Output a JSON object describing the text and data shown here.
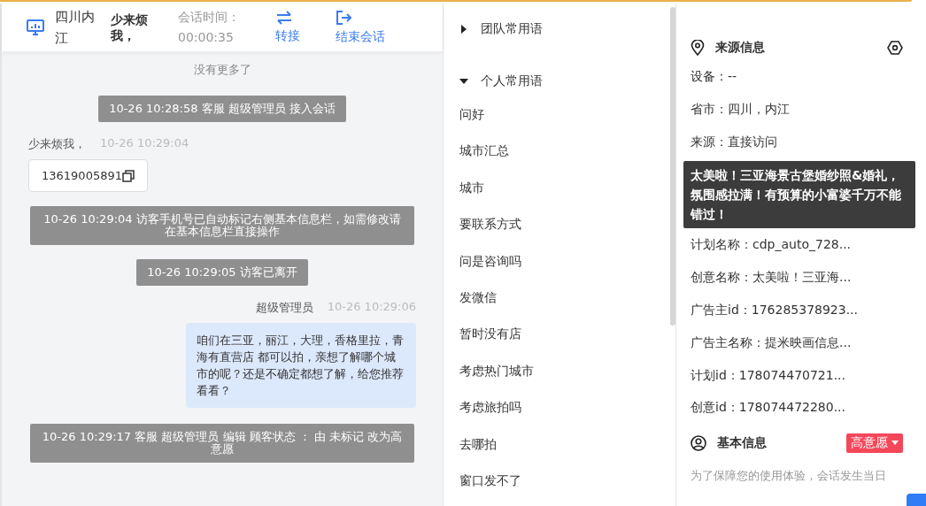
{
  "header": {
    "location": "四川内江",
    "visitor": "少来烦我，",
    "duration_label": "会话时间：",
    "duration": "00:00:35",
    "actions": [
      {
        "kind": "transfer",
        "label": "转接"
      },
      {
        "kind": "end",
        "label": "结束会话"
      }
    ]
  },
  "chat": [
    {
      "kind": "hint",
      "text": "没有更多了"
    },
    {
      "kind": "notice",
      "text": "10-26 10:28:58 客服 超级管理员 接入会话"
    },
    {
      "kind": "customer",
      "name": "少来烦我，",
      "time": "10-26 10:29:04",
      "text": "13619005891"
    },
    {
      "kind": "notice",
      "text": "10-26 10:29:04 访客手机号已自动标记右侧基本信息栏，如需修改请在基本信息栏直接操作"
    },
    {
      "kind": "notice",
      "text": "10-26 10:29:05 访客已离开"
    },
    {
      "kind": "agent",
      "name": "超级管理员",
      "time": "10-26 10:29:06",
      "text": "咱们在三亚，丽江，大理，香格里拉，青海有直营店 都可以拍，亲想了解哪个城市的呢？还是不确定都想了解，给您推荐看看？"
    },
    {
      "kind": "notice",
      "text": "10-26 10:29:17 客服 超级管理员 编辑 顾客状态 ： 由 未标记 改为高意愿"
    }
  ],
  "phrases": [
    {
      "label": "团队常用语",
      "expanded": false
    },
    {
      "label": "个人常用语",
      "expanded": true,
      "children": [
        "问好",
        "城市汇总",
        "城市",
        "要联系方式",
        "问是咨询吗",
        "发微信",
        "暂时没有店",
        "考虑热门城市",
        "考虑旅拍吗",
        "去哪拍",
        "窗口发不了"
      ]
    }
  ],
  "source_info": {
    "title": "来源信息",
    "rows_before": [
      "设备：--",
      "省市：四川，内江",
      "来源：直接访问"
    ],
    "rows_after": [
      "计划名称：cdp_auto_728...",
      "创意名称：太美啦！三亚海...",
      "广告主id：176285378923...",
      "广告主名称：提米映画信息...",
      "计划id：178074470721...",
      "创意id：178074472280..."
    ],
    "tooltip": "太美啦！三亚海景古堡婚纱照&婚礼，氛围感拉满！有预算的小富婆千万不能错过！"
  },
  "basic_info": {
    "title": "基本信息",
    "status": "高意愿",
    "note": "为了保障您的使用体验，会话发生当日"
  }
}
